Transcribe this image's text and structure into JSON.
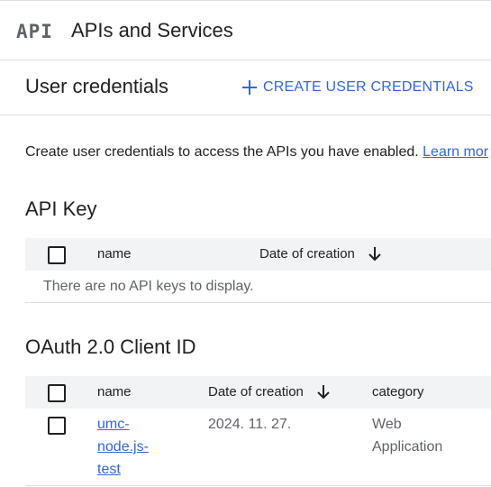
{
  "header": {
    "logo": "API",
    "title": "APIs and Services"
  },
  "section": {
    "title": "User credentials",
    "create_label": "CREATE USER CREDENTIALS"
  },
  "intro": {
    "text": "Create user credentials to access the APIs you have enabled.",
    "link": "Learn mor"
  },
  "api_key": {
    "title": "API Key",
    "columns": {
      "name": "name",
      "date": "Date of creation"
    },
    "empty_message": "There are no API keys to display."
  },
  "oauth": {
    "title": "OAuth 2.0 Client ID",
    "columns": {
      "name": "name",
      "date": "Date of creation",
      "category": "category"
    },
    "rows": [
      {
        "name_lines": [
          "umc-",
          "node.js-",
          "test"
        ],
        "date": "2024. 11. 27.",
        "category_lines": [
          "Web",
          "Application"
        ]
      }
    ]
  },
  "colors": {
    "accent": "#3367d6",
    "header_bg": "#f1f3f4",
    "divider": "#e0e0e0"
  },
  "icons": [
    "plus-icon",
    "sort-down-arrow-icon",
    "checkbox-icon"
  ]
}
